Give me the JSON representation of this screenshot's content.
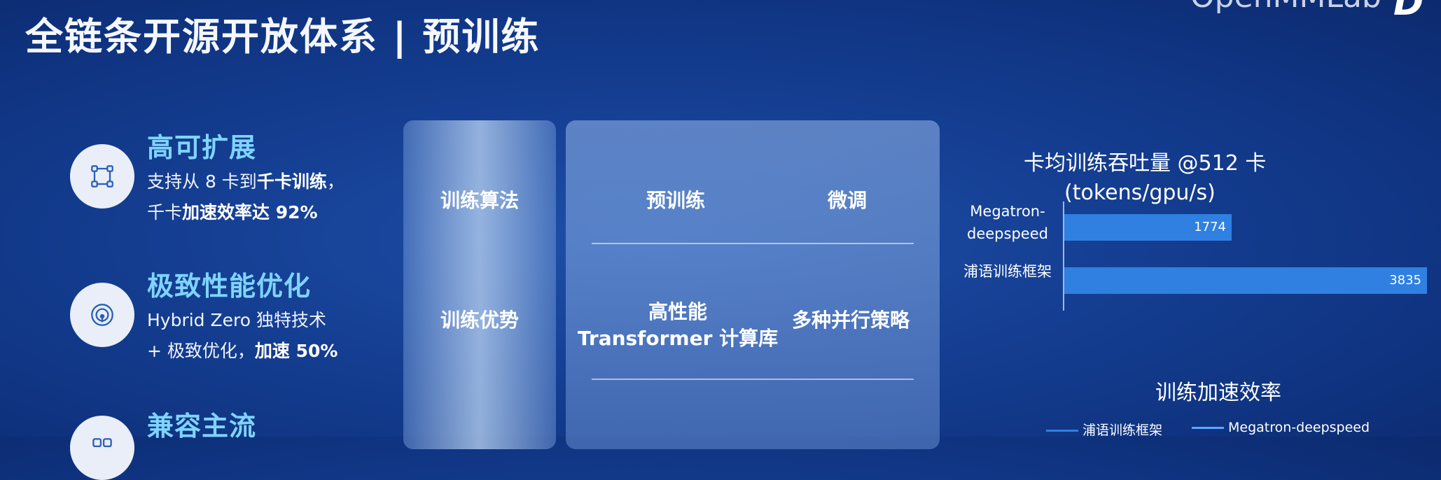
{
  "header": {
    "title": "全链条开源开放体系 | 预训练",
    "brand": "OpenMMLab"
  },
  "features": [
    {
      "title": "高可扩展",
      "line1_pre": "支持从 8 卡到",
      "line1_bold": "千卡训练",
      "line1_post": "，",
      "line2_pre": "千卡",
      "line2_bold": "加速效率达 92%",
      "line2_post": ""
    },
    {
      "title": "极致性能优化",
      "line1_pre": "Hybrid Zero 独特技术",
      "line1_bold": "",
      "line1_post": "",
      "line2_pre": "+ 极致优化，",
      "line2_bold": "加速 50%",
      "line2_post": ""
    },
    {
      "title": "兼容主流"
    }
  ],
  "table": {
    "rows": [
      "训练算法",
      "训练优势"
    ],
    "cells": {
      "pretrain": "预训练",
      "finetune": "微调",
      "hpc_line1": "高性能",
      "hpc_line2": "Transformer 计算库",
      "parallel": "多种并行策略"
    }
  },
  "chart_data": [
    {
      "type": "bar",
      "orientation": "horizontal",
      "title": "卡均训练吞吐量 @512 卡",
      "subtitle": "(tokens/gpu/s)",
      "categories": [
        "Megatron-deepspeed",
        "浦语训练框架"
      ],
      "values": [
        1774,
        3835
      ],
      "data_labels": [
        "1774",
        "3835"
      ],
      "xlim": [
        0,
        4000
      ],
      "colors": [
        "#2f80e0",
        "#2f80e0"
      ]
    },
    {
      "type": "line",
      "title": "训练加速效率",
      "series": [
        {
          "name": "浦语训练框架",
          "color": "#2f80e0"
        },
        {
          "name": "Megatron-deepspeed",
          "color": "#5aa8ff"
        }
      ]
    }
  ]
}
